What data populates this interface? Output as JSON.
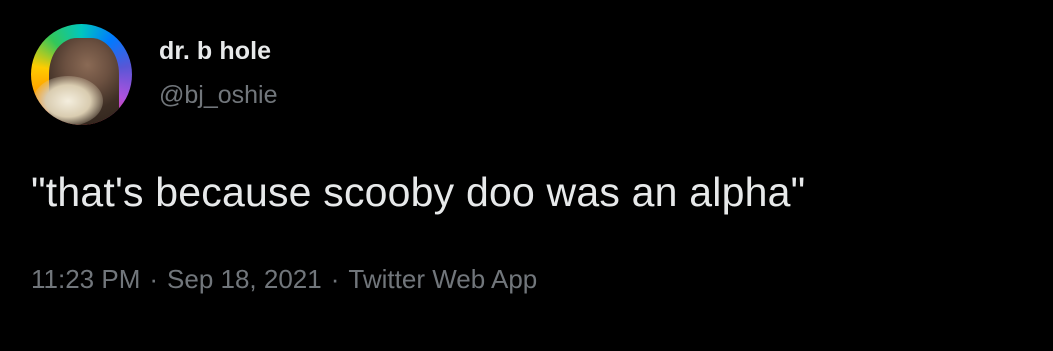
{
  "author": {
    "display_name": "dr. b hole",
    "handle": "@bj_oshie"
  },
  "tweet": {
    "text": "\"that's because scooby doo was an alpha\""
  },
  "meta": {
    "time": "11:23 PM",
    "separator": "·",
    "date": "Sep 18, 2021",
    "source": "Twitter Web App"
  },
  "colors": {
    "background": "#000000",
    "primary_text": "#e7e9ea",
    "secondary_text": "#71767b"
  }
}
